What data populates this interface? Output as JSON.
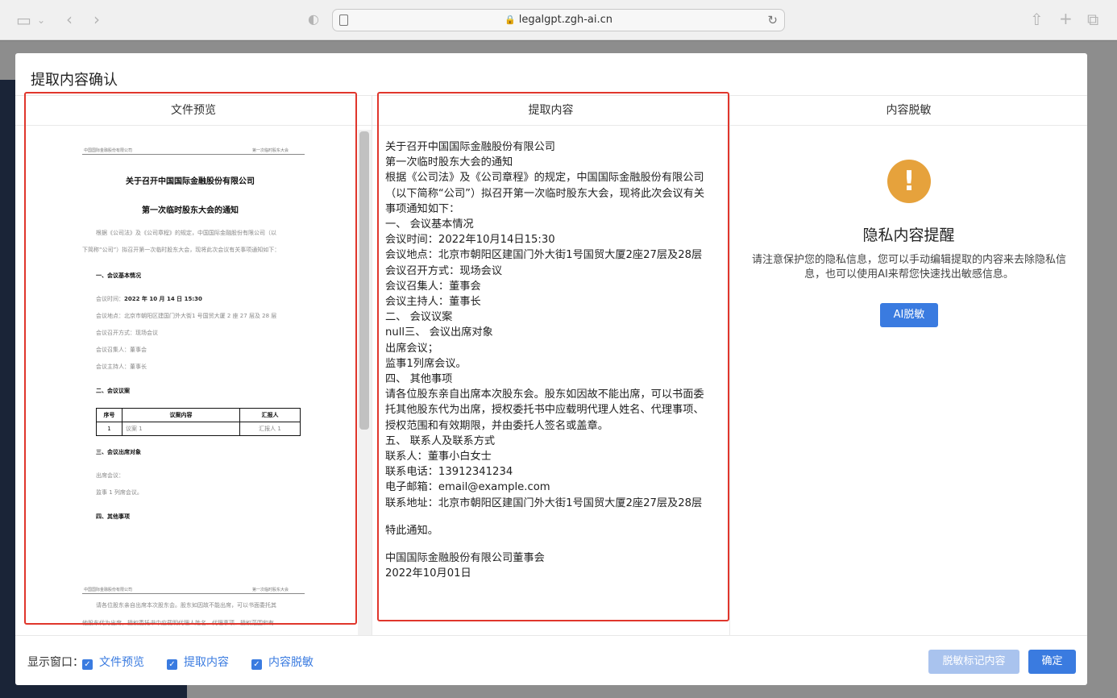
{
  "browser": {
    "url": "legalgpt.zgh-ai.cn"
  },
  "modal": {
    "title": "提取内容确认",
    "panels": {
      "preview": "文件预览",
      "extract": "提取内容",
      "desensitize": "内容脱敏"
    }
  },
  "doc": {
    "header_left": "中国国际金融股份有限公司",
    "header_right": "第一次临时股东大会",
    "title1": "关于召开中国国际金融股份有限公司",
    "title2": "第一次临时股东大会的通知",
    "para1a": "根据《公司法》及《公司章程》的规定，中国国际金融股份有限公司（以",
    "para1b": "下简称“公司”）拟召开第一次临时股东大会，现将此次会议有关事项通知如下：",
    "sec1": "一、会议基本情况",
    "time_label": "会议时间：",
    "time_value": "2022 年 10 月 14 日 15:30",
    "place_label": "会议地点：北京市朝阳区建国门外大街",
    "place_value": "1 号国贸大厦 2 座 27 层及 28 层",
    "mode": "会议召开方式：现场会议",
    "convener": "会议召集人：董事会",
    "host": "会议主持人：董事长",
    "sec2": "二、会议议案",
    "table_headers": [
      "序号",
      "议案内容",
      "汇报人"
    ],
    "table_row": [
      "1",
      "议案 1",
      "汇报人 1"
    ],
    "sec3": "三、会议出席对象",
    "attend1": "出席会议：",
    "attend2": "监事 1 列席会议。",
    "sec4": "四、其他事项",
    "page2_line1": "请各位股东亲自出席本次股东会。股东如因故不能出席，可以书面委托其",
    "page2_line2": "他股东代为出席，授权委托书中应载明代理人姓名、代理事项、授权范围和有"
  },
  "extract": {
    "lines": [
      "关于召开中国国际金融股份有限公司",
      "第一次临时股东大会的通知",
      "根据《公司法》及《公司章程》的规定，中国国际金融股份有限公司",
      "（以下简称“公司”）拟召开第一次临时股东大会，现将此次会议有关",
      "事项通知如下：",
      "一、 会议基本情况",
      "会议时间：2022年10月14日15:30",
      "会议地点：北京市朝阳区建国门外大街1号国贸大厦2座27层及28层",
      "会议召开方式：现场会议",
      "会议召集人：董事会",
      "会议主持人：董事长",
      "二、 会议议案",
      "null三、 会议出席对象",
      "出席会议；",
      "监事1列席会议。",
      "四、 其他事项",
      "请各位股东亲自出席本次股东会。股东如因故不能出席，可以书面委",
      "托其他股东代为出席，授权委托书中应载明代理人姓名、代理事项、",
      "授权范围和有效期限，并由委托人签名或盖章。",
      "五、 联系人及联系方式",
      "联系人：董事小白女士",
      "联系电话：13912341234",
      "电子邮箱：email@example.com",
      "联系地址：北京市朝阳区建国门外大街1号国贸大厦2座27层及28层"
    ],
    "closing": "特此通知。",
    "signer": "中国国际金融股份有限公司董事会",
    "date": "2022年10月01日"
  },
  "privacy": {
    "title": "隐私内容提醒",
    "desc": "请注意保护您的隐私信息，您可以手动编辑提取的内容来去除隐私信息，也可以使用AI来帮您快速找出敏感信息。",
    "ai_button": "AI脱敏",
    "icon": "warning-icon",
    "icon_color": "#e6a23c"
  },
  "footer": {
    "label": "显示窗口：",
    "checks": [
      "文件预览",
      "提取内容",
      "内容脱敏"
    ],
    "mask_button": "脱敏标记内容",
    "ok_button": "确定"
  },
  "colors": {
    "primary": "#3a7be0",
    "highlight": "#e0362c"
  }
}
